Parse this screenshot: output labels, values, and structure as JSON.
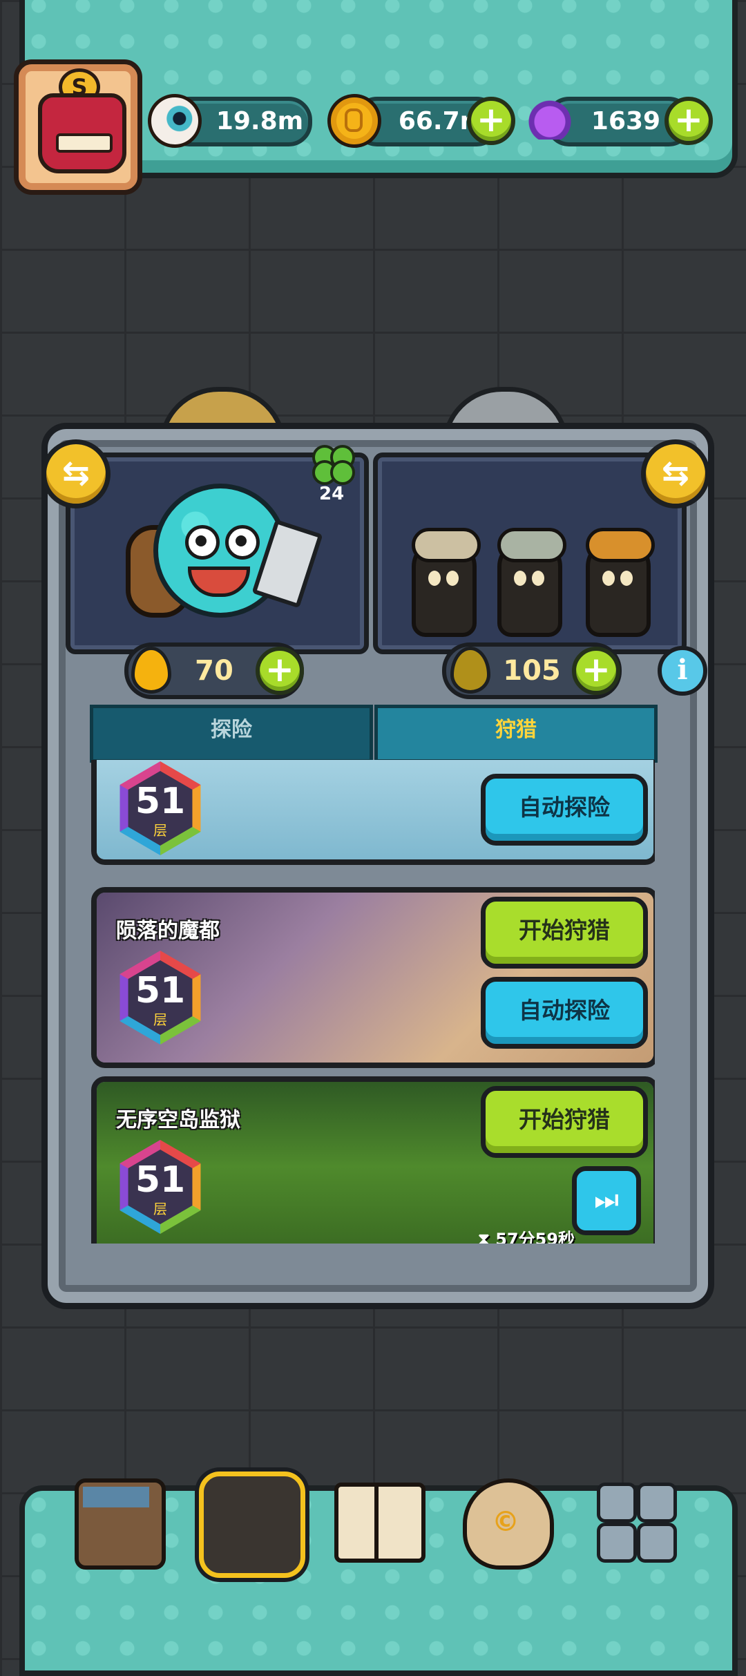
{
  "resources": {
    "eyeballs": "19.8m",
    "coins": "66.7m",
    "potions": "1639"
  },
  "profile": {
    "rank_badge": "S"
  },
  "chamber": {
    "clover_count": "24",
    "gold_drops": "70",
    "dark_drops": "105"
  },
  "tabs": [
    {
      "label": "探险",
      "active": false
    },
    {
      "label": "狩猎",
      "active": true
    }
  ],
  "levels": [
    {
      "name": "",
      "floor": "51",
      "floor_unit": "层",
      "auto_label": "自动探险"
    },
    {
      "name": "陨落的魔都",
      "floor": "51",
      "floor_unit": "层",
      "start_label": "开始狩猎",
      "auto_label": "自动探险"
    },
    {
      "name": "无序空岛监狱",
      "floor": "51",
      "floor_unit": "层",
      "start_label": "开始狩猎",
      "timer": "57分59秒"
    }
  ],
  "nav": {
    "items": [
      "shop-icon",
      "hunt-icon",
      "codex-icon",
      "money-bag-icon",
      "menu-grid-icon"
    ],
    "active": "hunt-icon"
  },
  "colors": {
    "accent_green": "#a9dd2c",
    "accent_blue": "#2fc6ea",
    "tab_active_text": "#ffd43b"
  }
}
